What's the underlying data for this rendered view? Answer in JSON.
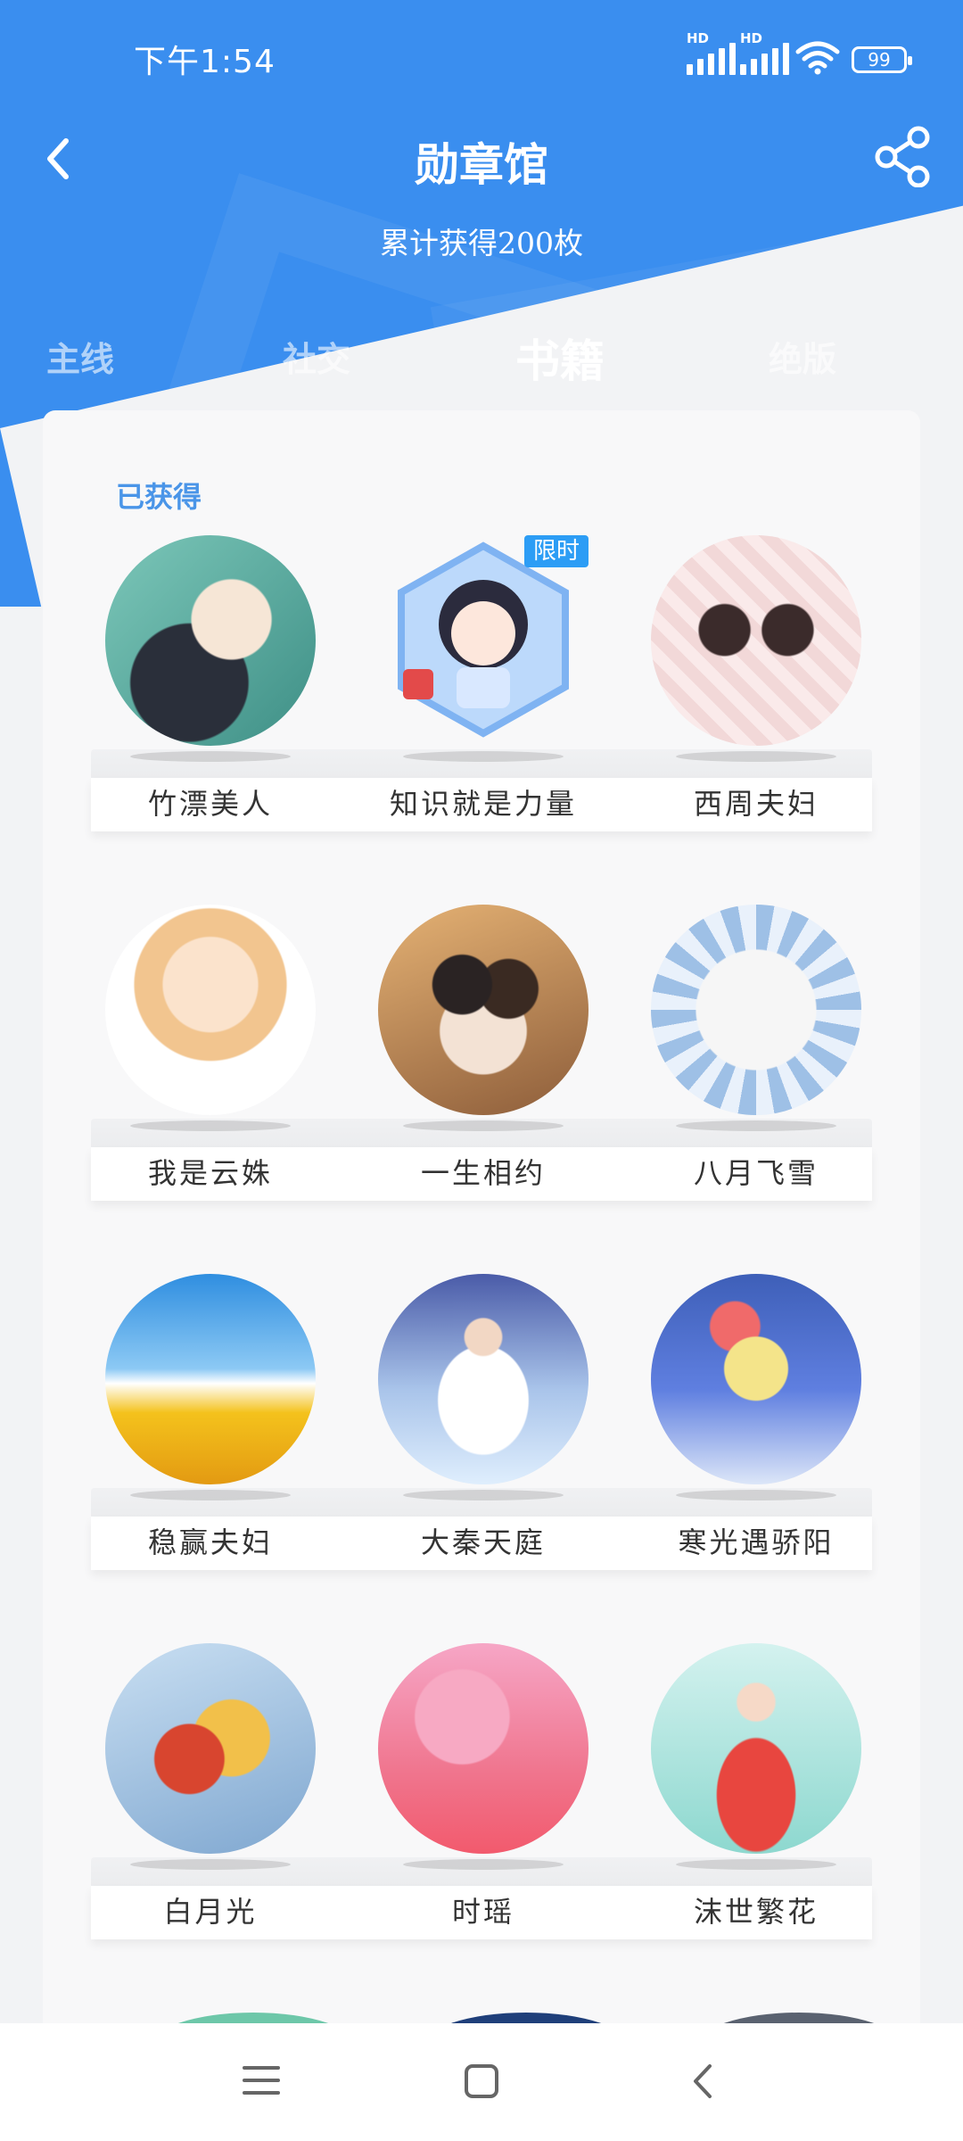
{
  "status_bar": {
    "time": "下午1:54",
    "signal_label": "HD",
    "battery": "99"
  },
  "header": {
    "title": "勋章馆",
    "subtitle": "累计获得200枚"
  },
  "tabs": [
    {
      "label": "主线"
    },
    {
      "label": "社交"
    },
    {
      "label": "书籍",
      "active": true
    },
    {
      "label": "绝版"
    }
  ],
  "section": {
    "label": "已获得"
  },
  "limited_tag": "限时",
  "badges": [
    {
      "name": "竹漂美人"
    },
    {
      "name": "知识就是力量"
    },
    {
      "name": "西周夫妇"
    },
    {
      "name": "我是云姝"
    },
    {
      "name": "一生相约"
    },
    {
      "name": "八月飞雪"
    },
    {
      "name": "稳赢夫妇"
    },
    {
      "name": "大秦天庭"
    },
    {
      "name": "寒光遇骄阳"
    },
    {
      "name": "白月光"
    },
    {
      "name": "时瑶"
    },
    {
      "name": "沫世繁花"
    }
  ],
  "colors": {
    "header_blue": "#3a8eef",
    "section_label": "#4a95e8",
    "limited_tag": "#2c9df5"
  },
  "nav_bar": {
    "icons": [
      "menu-icon",
      "home-icon",
      "back-icon"
    ]
  }
}
